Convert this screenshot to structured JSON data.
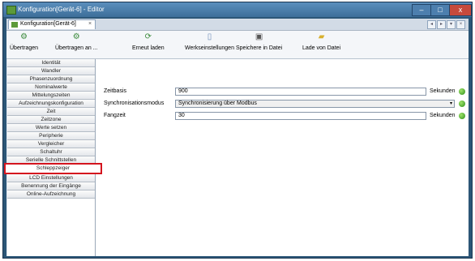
{
  "window": {
    "title": "Konfiguration[Gerät-6] - Editor",
    "min": "–",
    "max": "□",
    "close": "x"
  },
  "tab": {
    "label": "Konfiguration[Gerät-6]",
    "close": "×"
  },
  "tab_nav": [
    "◂",
    "▸",
    "▾",
    "×"
  ],
  "toolbar": [
    {
      "label": "Übertragen",
      "icon": "gear-icon",
      "glyph": "⚙",
      "color": "#3c8a3c"
    },
    {
      "label": "Übertragen an ...",
      "icon": "gear-icon",
      "glyph": "⚙",
      "color": "#3c8a3c"
    },
    {
      "label": "Erneut laden",
      "icon": "refresh-icon",
      "glyph": "⟳",
      "color": "#3c8a3c"
    },
    {
      "label": "Werkseinstellungen",
      "icon": "document-icon",
      "glyph": "▯",
      "color": "#6b8bb8"
    },
    {
      "label": "Speichere in Datei",
      "icon": "save-icon",
      "glyph": "▣",
      "color": "#555"
    },
    {
      "label": "Lade von Datei",
      "icon": "folder-icon",
      "glyph": "▰",
      "color": "#d8b02e"
    }
  ],
  "nav": [
    "Identität",
    "Wandler",
    "Phasenzuordnung",
    "Nominalwerte",
    "Mittelungszeiten",
    "Aufzeichnungskonfiguration",
    "Zeit",
    "Zeitzone",
    "Werte setzen",
    "Peripherie",
    "Vergleicher",
    "Schaltuhr",
    "Serielle Schnittstellen",
    "Schleppzeiger",
    "LCD Einstellungen",
    "Benennung der Eingänge",
    "Online-Aufzeichnung"
  ],
  "selected_nav": "Schleppzeiger",
  "fields": {
    "zeitbasis": {
      "label": "Zeitbasis",
      "value": "900",
      "unit": "Sekunden"
    },
    "sync": {
      "label": "Synchronisationsmodus",
      "value": "Synchronisierung über Modbus",
      "arrow": "▾"
    },
    "fangzeit": {
      "label": "Fangzeit",
      "value": "30",
      "unit": "Sekunden"
    }
  }
}
